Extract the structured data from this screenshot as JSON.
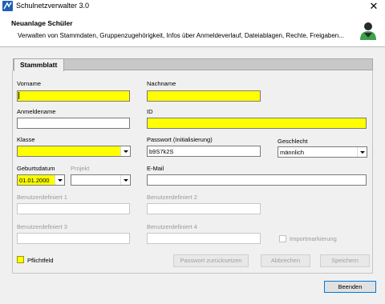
{
  "window": {
    "title": "Schulnetzverwalter 3.0",
    "close_glyph": "✕"
  },
  "header": {
    "title": "Neuanlage Schüler",
    "subtitle": "Verwalten von Stammdaten, Gruppenzugehörigkeit, Infos über Anmeldeverlauf, Dateiablagen, Rechte, Freigaben..."
  },
  "tab": {
    "label": "Stammblatt"
  },
  "form": {
    "vorname": {
      "label": "Vorname",
      "value": "",
      "required": true
    },
    "nachname": {
      "label": "Nachname",
      "value": "",
      "required": true
    },
    "anmeldename": {
      "label": "Anmeldename",
      "value": ""
    },
    "id": {
      "label": "ID",
      "value": "",
      "required": true
    },
    "klasse": {
      "label": "Klasse",
      "value": "",
      "required": true
    },
    "passwort": {
      "label": "Passwort (Initialisierung)",
      "value": "b9S7k2S"
    },
    "geschlecht": {
      "label": "Geschlecht",
      "value": "männlich"
    },
    "geburtsdatum": {
      "label": "Geburtsdatum",
      "value": "01.01.2000",
      "required": true
    },
    "projekt": {
      "label": "Projekt",
      "value": ""
    },
    "email": {
      "label": "E-Mail",
      "value": ""
    },
    "benutzer1": {
      "label": "Benutzerdefiniert 1",
      "value": ""
    },
    "benutzer2": {
      "label": "Benutzerdefiniert 2",
      "value": ""
    },
    "benutzer3": {
      "label": "Benutzerdefiniert 3",
      "value": ""
    },
    "benutzer4": {
      "label": "Benutzerdefiniert 4",
      "value": ""
    },
    "importmarkierung": {
      "label": "Importmarkierung",
      "checked": false
    }
  },
  "legend": {
    "label": "Pflichtfeld",
    "color": "#ffff00"
  },
  "buttons": {
    "reset_password": "Passwort zurücksetzen",
    "cancel": "Abbrechen",
    "save": "Speichern",
    "close": "Beenden"
  },
  "icons": {
    "app": "app-icon",
    "student": "student-avatar-icon"
  }
}
